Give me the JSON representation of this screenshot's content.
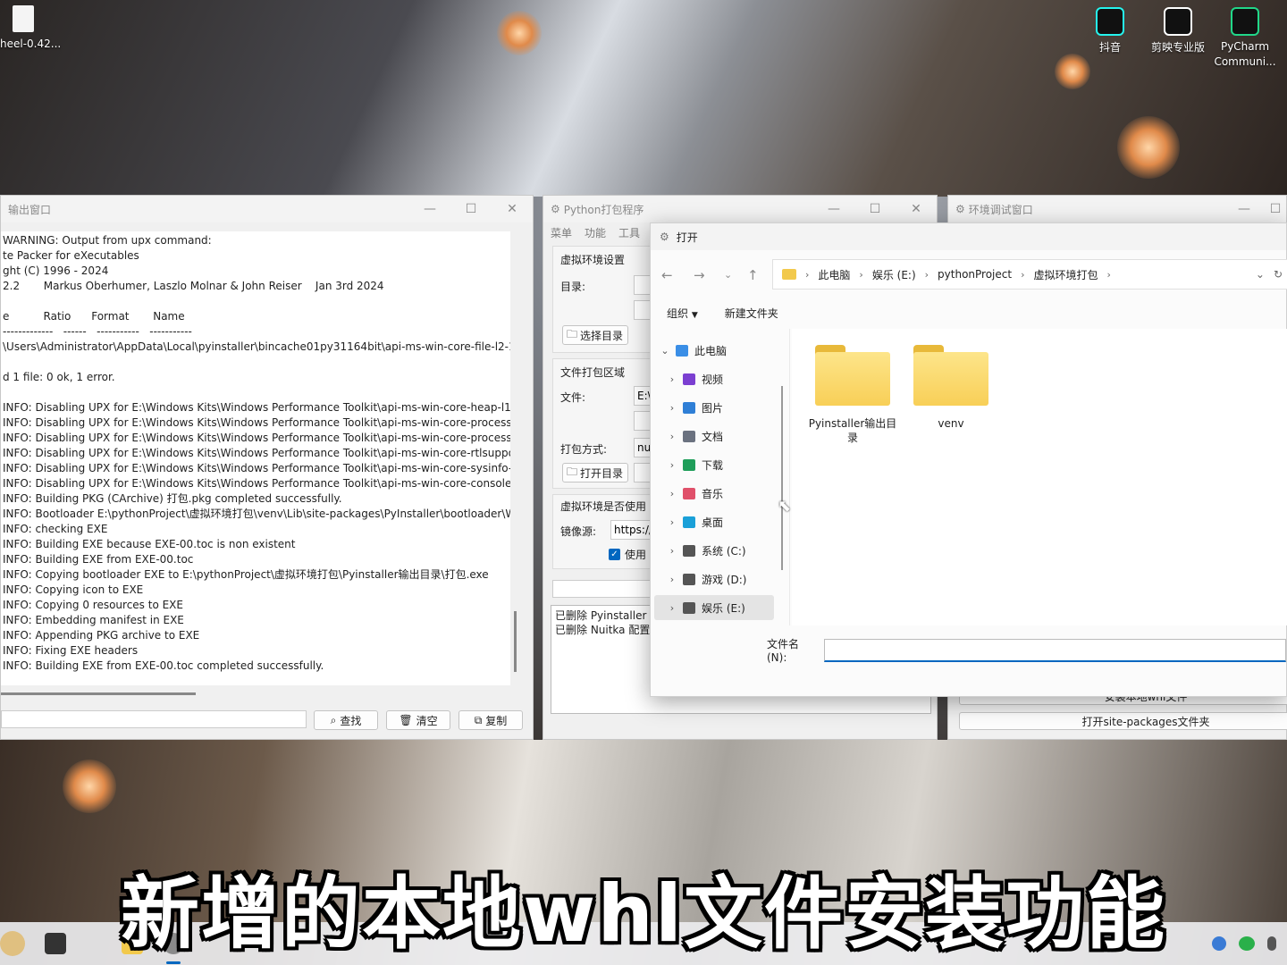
{
  "desktop": {
    "file_label": "heel-0.42...",
    "icons": [
      {
        "label": "抖音"
      },
      {
        "label": "剪映专业版"
      },
      {
        "label": "PyCharm Communi..."
      }
    ]
  },
  "output_window": {
    "title": "输出窗口",
    "lines": [
      "WARNING: Output from upx command:",
      "te Packer for eXecutables",
      "ght (C) 1996 - 2024",
      "2.2       Markus Oberhumer, Laszlo Molnar & John Reiser    Jan 3rd 2024",
      "",
      "e          Ratio      Format       Name",
      "-------------   ------   -----------   -----------",
      "\\Users\\Administrator\\AppData\\Local\\pyinstaller\\bincache01py31164bit\\api-ms-win-core-file-l2-1-",
      "",
      "d 1 file: 0 ok, 1 error.",
      "",
      "INFO: Disabling UPX for E:\\Windows Kits\\Windows Performance Toolkit\\api-ms-win-core-heap-l1",
      "INFO: Disabling UPX for E:\\Windows Kits\\Windows Performance Toolkit\\api-ms-win-core-process",
      "INFO: Disabling UPX for E:\\Windows Kits\\Windows Performance Toolkit\\api-ms-win-core-process",
      "INFO: Disabling UPX for E:\\Windows Kits\\Windows Performance Toolkit\\api-ms-win-core-rtlsuppo",
      "INFO: Disabling UPX for E:\\Windows Kits\\Windows Performance Toolkit\\api-ms-win-core-sysinfo-",
      "INFO: Disabling UPX for E:\\Windows Kits\\Windows Performance Toolkit\\api-ms-win-core-console",
      "INFO: Building PKG (CArchive) 打包.pkg completed successfully.",
      "INFO: Bootloader E:\\pythonProject\\虚拟环境打包\\venv\\Lib\\site-packages\\PyInstaller\\bootloader\\W",
      "INFO: checking EXE",
      "INFO: Building EXE because EXE-00.toc is non existent",
      "INFO: Building EXE from EXE-00.toc",
      "INFO: Copying bootloader EXE to E:\\pythonProject\\虚拟环境打包\\Pyinstaller输出目录\\打包.exe",
      "INFO: Copying icon to EXE",
      "INFO: Copying 0 resources to EXE",
      "INFO: Embedding manifest in EXE",
      "INFO: Appending PKG archive to EXE",
      "INFO: Fixing EXE headers",
      "INFO: Building EXE from EXE-00.toc completed successfully."
    ],
    "buttons": {
      "search": "查找",
      "clear": "清空",
      "copy": "复制"
    }
  },
  "packager_window": {
    "title": "Python打包程序",
    "menu": [
      "菜单",
      "功能",
      "工具"
    ],
    "venv_group": "虚拟环境设置",
    "dir_label": "目录:",
    "choose_dir_btn": "选择目录",
    "pack_group": "文件打包区域",
    "file_label": "文件:",
    "file_value": "E:\\",
    "pack_mode_label": "打包方式:",
    "pack_mode_value": "nui",
    "open_dir_btn": "打开目录",
    "use_venv_group": "虚拟环境是否使用",
    "mirror_label": "镜像源:",
    "mirror_value": "https://",
    "use_checkbox": "使用",
    "log_lines": [
      "已删除 Pyinstaller 配",
      "已删除 Nuitka 配置"
    ]
  },
  "env_window": {
    "title": "环境调试窗口",
    "partial_btn": "安装本地whl文件",
    "open_site_packages": "打开site-packages文件夹"
  },
  "open_dialog": {
    "title": "打开",
    "breadcrumb": [
      "此电脑",
      "娱乐 (E:)",
      "pythonProject",
      "虚拟环境打包"
    ],
    "organize": "组织",
    "new_folder": "新建文件夹",
    "tree": [
      {
        "label": "此电脑",
        "icon": "computer-icon",
        "color": "#3a8ee6"
      },
      {
        "label": "视频",
        "icon": "video-icon",
        "color": "#7b3fd1"
      },
      {
        "label": "图片",
        "icon": "picture-icon",
        "color": "#2f7fd6"
      },
      {
        "label": "文档",
        "icon": "document-icon",
        "color": "#6b7280"
      },
      {
        "label": "下载",
        "icon": "download-icon",
        "color": "#1f9e5a"
      },
      {
        "label": "音乐",
        "icon": "music-icon",
        "color": "#e0506a"
      },
      {
        "label": "桌面",
        "icon": "desktop-icon",
        "color": "#1aa0d8"
      },
      {
        "label": "系统 (C:)",
        "icon": "drive-icon",
        "color": "#555555"
      },
      {
        "label": "游戏 (D:)",
        "icon": "drive-icon",
        "color": "#555555"
      },
      {
        "label": "娱乐 (E:)",
        "icon": "drive-icon",
        "color": "#555555"
      }
    ],
    "folders": [
      {
        "name": "Pyinstaller输出目录"
      },
      {
        "name": "venv"
      }
    ],
    "filename_label": "文件名(N):",
    "filename_value": ""
  },
  "caption": "新增的本地whl文件安装功能"
}
